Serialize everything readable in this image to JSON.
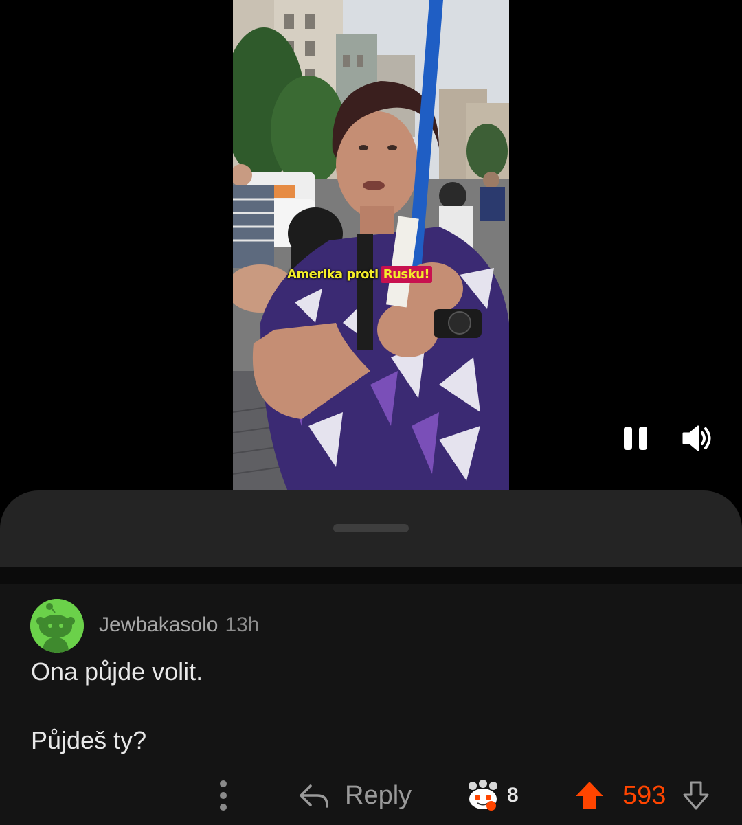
{
  "video": {
    "caption_part1": "Amerika proti",
    "caption_part2": "Rusku!",
    "state": "playing"
  },
  "comment": {
    "username": "Jewbakasolo",
    "timestamp": "13h",
    "body": [
      "Ona půjde volit.",
      "Půjdeš ty?"
    ]
  },
  "actions": {
    "reply_label": "Reply",
    "award_count": "8",
    "score": "593",
    "vote_state": "upvoted"
  },
  "colors": {
    "upvote": "#ff4500",
    "avatar": "#6bd14a",
    "caption_highlight": "#c8114f",
    "caption_text": "#f3ec2a"
  },
  "icons": {
    "pause": "pause-icon",
    "volume": "volume-icon",
    "more": "more-vertical-icon",
    "reply": "reply-arrow-icon",
    "award": "award-icon",
    "upvote": "upvote-arrow-icon",
    "downvote": "downvote-arrow-icon",
    "avatar": "snoo-avatar-icon"
  }
}
